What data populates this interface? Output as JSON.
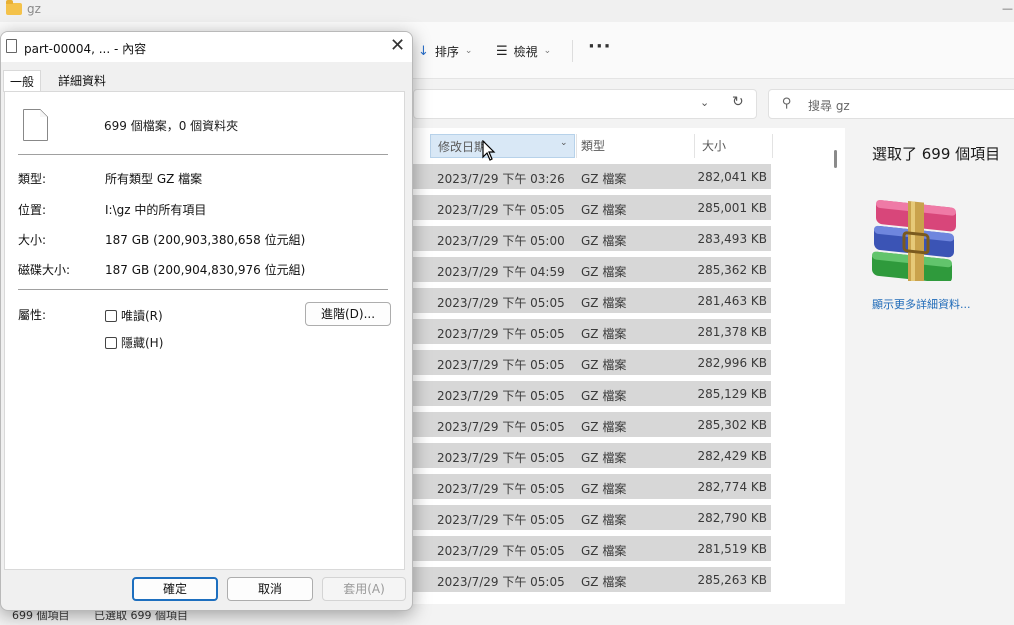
{
  "explorer": {
    "window_title": "gz",
    "toolbar": {
      "sort_label": "排序",
      "view_label": "檢視",
      "more_label": "···"
    },
    "search_placeholder": "搜尋 gz",
    "columns": {
      "date": "修改日期",
      "type": "類型",
      "size": "大小"
    },
    "rows": [
      {
        "date": "2023/7/29 下午 03:26",
        "type": "GZ 檔案",
        "size": "282,041 KB"
      },
      {
        "date": "2023/7/29 下午 05:05",
        "type": "GZ 檔案",
        "size": "285,001 KB"
      },
      {
        "date": "2023/7/29 下午 05:00",
        "type": "GZ 檔案",
        "size": "283,493 KB"
      },
      {
        "date": "2023/7/29 下午 04:59",
        "type": "GZ 檔案",
        "size": "285,362 KB"
      },
      {
        "date": "2023/7/29 下午 05:05",
        "type": "GZ 檔案",
        "size": "281,463 KB"
      },
      {
        "date": "2023/7/29 下午 05:05",
        "type": "GZ 檔案",
        "size": "281,378 KB"
      },
      {
        "date": "2023/7/29 下午 05:05",
        "type": "GZ 檔案",
        "size": "282,996 KB"
      },
      {
        "date": "2023/7/29 下午 05:05",
        "type": "GZ 檔案",
        "size": "285,129 KB"
      },
      {
        "date": "2023/7/29 下午 05:05",
        "type": "GZ 檔案",
        "size": "285,302 KB"
      },
      {
        "date": "2023/7/29 下午 05:05",
        "type": "GZ 檔案",
        "size": "282,429 KB"
      },
      {
        "date": "2023/7/29 下午 05:05",
        "type": "GZ 檔案",
        "size": "282,774 KB"
      },
      {
        "date": "2023/7/29 下午 05:05",
        "type": "GZ 檔案",
        "size": "282,790 KB"
      },
      {
        "date": "2023/7/29 下午 05:05",
        "type": "GZ 檔案",
        "size": "281,519 KB"
      },
      {
        "date": "2023/7/29 下午 05:05",
        "type": "GZ 檔案",
        "size": "285,263 KB"
      }
    ],
    "details_pane": {
      "title": "選取了 699 個項目",
      "link": "顯示更多詳細資料..."
    },
    "status": {
      "count": "699 個項目",
      "selected": "已選取 699 個項目"
    }
  },
  "dialog": {
    "title": "part-00004, ... - 內容",
    "tabs": [
      "一般",
      "詳細資料"
    ],
    "summary": "699 個檔案，0 個資料夾",
    "fields": [
      {
        "label": "類型:",
        "value": "所有類型 GZ 檔案"
      },
      {
        "label": "位置:",
        "value": "I:\\gz 中的所有項目"
      },
      {
        "label": "大小:",
        "value": "187 GB (200,903,380,658 位元組)"
      },
      {
        "label": "磁碟大小:",
        "value": "187 GB (200,904,830,976 位元組)"
      }
    ],
    "attributes_label": "屬性:",
    "readonly_label": "唯讀(R)",
    "hidden_label": "隱藏(H)",
    "advanced_label": "進階(D)...",
    "ok_label": "確定",
    "cancel_label": "取消",
    "apply_label": "套用(A)"
  }
}
